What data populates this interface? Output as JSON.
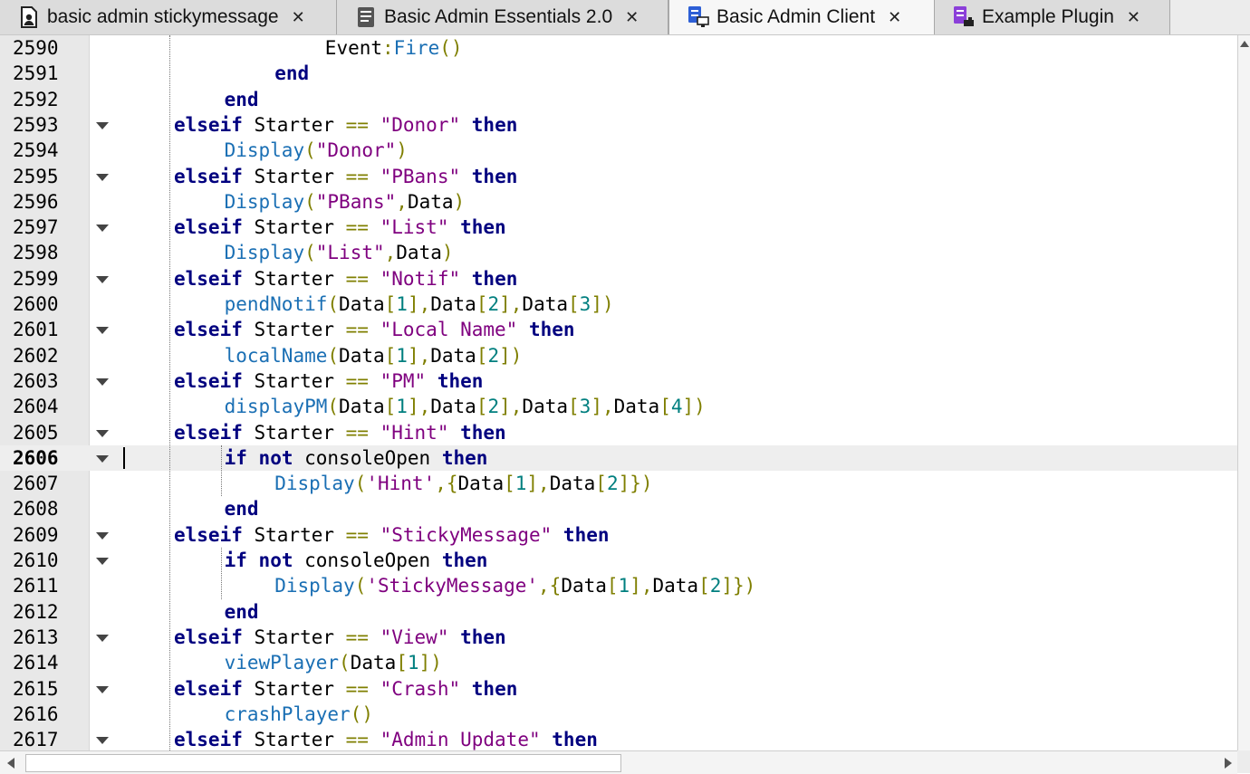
{
  "tabs": [
    {
      "label": "basic admin stickymessage",
      "icon": "script-person-icon",
      "active": false
    },
    {
      "label": "Basic Admin Essentials 2.0",
      "icon": "document-lines-icon",
      "active": false
    },
    {
      "label": "Basic Admin Client",
      "icon": "local-script-icon",
      "active": true
    },
    {
      "label": "Example Plugin",
      "icon": "module-script-icon",
      "active": false
    }
  ],
  "tab_close_glyph": "✕",
  "editor": {
    "current_line": 2606,
    "lines": [
      {
        "n": 2590,
        "fold": false,
        "indent": 3,
        "tokens": [
          [
            "id",
            "Event"
          ],
          [
            "op",
            ":"
          ],
          [
            "fn",
            "Fire"
          ],
          [
            "op",
            "()"
          ]
        ]
      },
      {
        "n": 2591,
        "fold": false,
        "indent": 2,
        "tokens": [
          [
            "kw",
            "end"
          ]
        ]
      },
      {
        "n": 2592,
        "fold": false,
        "indent": 1,
        "tokens": [
          [
            "kw",
            "end"
          ]
        ]
      },
      {
        "n": 2593,
        "fold": true,
        "indent": 0,
        "tokens": [
          [
            "kw",
            "elseif"
          ],
          [
            "id",
            " Starter "
          ],
          [
            "op",
            "=="
          ],
          [
            "id",
            " "
          ],
          [
            "st",
            "\"Donor\""
          ],
          [
            "id",
            " "
          ],
          [
            "kw",
            "then"
          ]
        ]
      },
      {
        "n": 2594,
        "fold": false,
        "indent": 1,
        "tokens": [
          [
            "fn",
            "Display"
          ],
          [
            "op",
            "("
          ],
          [
            "st",
            "\"Donor\""
          ],
          [
            "op",
            ")"
          ]
        ]
      },
      {
        "n": 2595,
        "fold": true,
        "indent": 0,
        "tokens": [
          [
            "kw",
            "elseif"
          ],
          [
            "id",
            " Starter "
          ],
          [
            "op",
            "=="
          ],
          [
            "id",
            " "
          ],
          [
            "st",
            "\"PBans\""
          ],
          [
            "id",
            " "
          ],
          [
            "kw",
            "then"
          ]
        ]
      },
      {
        "n": 2596,
        "fold": false,
        "indent": 1,
        "tokens": [
          [
            "fn",
            "Display"
          ],
          [
            "op",
            "("
          ],
          [
            "st",
            "\"PBans\""
          ],
          [
            "op",
            ","
          ],
          [
            "id",
            "Data"
          ],
          [
            "op",
            ")"
          ]
        ]
      },
      {
        "n": 2597,
        "fold": true,
        "indent": 0,
        "tokens": [
          [
            "kw",
            "elseif"
          ],
          [
            "id",
            " Starter "
          ],
          [
            "op",
            "=="
          ],
          [
            "id",
            " "
          ],
          [
            "st",
            "\"List\""
          ],
          [
            "id",
            " "
          ],
          [
            "kw",
            "then"
          ]
        ]
      },
      {
        "n": 2598,
        "fold": false,
        "indent": 1,
        "tokens": [
          [
            "fn",
            "Display"
          ],
          [
            "op",
            "("
          ],
          [
            "st",
            "\"List\""
          ],
          [
            "op",
            ","
          ],
          [
            "id",
            "Data"
          ],
          [
            "op",
            ")"
          ]
        ]
      },
      {
        "n": 2599,
        "fold": true,
        "indent": 0,
        "tokens": [
          [
            "kw",
            "elseif"
          ],
          [
            "id",
            " Starter "
          ],
          [
            "op",
            "=="
          ],
          [
            "id",
            " "
          ],
          [
            "st",
            "\"Notif\""
          ],
          [
            "id",
            " "
          ],
          [
            "kw",
            "then"
          ]
        ]
      },
      {
        "n": 2600,
        "fold": false,
        "indent": 1,
        "tokens": [
          [
            "fn",
            "pendNotif"
          ],
          [
            "op",
            "("
          ],
          [
            "id",
            "Data"
          ],
          [
            "op",
            "["
          ],
          [
            "nm",
            "1"
          ],
          [
            "op",
            "],"
          ],
          [
            "id",
            "Data"
          ],
          [
            "op",
            "["
          ],
          [
            "nm",
            "2"
          ],
          [
            "op",
            "],"
          ],
          [
            "id",
            "Data"
          ],
          [
            "op",
            "["
          ],
          [
            "nm",
            "3"
          ],
          [
            "op",
            "])"
          ]
        ]
      },
      {
        "n": 2601,
        "fold": true,
        "indent": 0,
        "tokens": [
          [
            "kw",
            "elseif"
          ],
          [
            "id",
            " Starter "
          ],
          [
            "op",
            "=="
          ],
          [
            "id",
            " "
          ],
          [
            "st",
            "\"Local Name\""
          ],
          [
            "id",
            " "
          ],
          [
            "kw",
            "then"
          ]
        ]
      },
      {
        "n": 2602,
        "fold": false,
        "indent": 1,
        "tokens": [
          [
            "fn",
            "localName"
          ],
          [
            "op",
            "("
          ],
          [
            "id",
            "Data"
          ],
          [
            "op",
            "["
          ],
          [
            "nm",
            "1"
          ],
          [
            "op",
            "],"
          ],
          [
            "id",
            "Data"
          ],
          [
            "op",
            "["
          ],
          [
            "nm",
            "2"
          ],
          [
            "op",
            "])"
          ]
        ]
      },
      {
        "n": 2603,
        "fold": true,
        "indent": 0,
        "tokens": [
          [
            "kw",
            "elseif"
          ],
          [
            "id",
            " Starter "
          ],
          [
            "op",
            "=="
          ],
          [
            "id",
            " "
          ],
          [
            "st",
            "\"PM\""
          ],
          [
            "id",
            " "
          ],
          [
            "kw",
            "then"
          ]
        ]
      },
      {
        "n": 2604,
        "fold": false,
        "indent": 1,
        "tokens": [
          [
            "fn",
            "displayPM"
          ],
          [
            "op",
            "("
          ],
          [
            "id",
            "Data"
          ],
          [
            "op",
            "["
          ],
          [
            "nm",
            "1"
          ],
          [
            "op",
            "],"
          ],
          [
            "id",
            "Data"
          ],
          [
            "op",
            "["
          ],
          [
            "nm",
            "2"
          ],
          [
            "op",
            "],"
          ],
          [
            "id",
            "Data"
          ],
          [
            "op",
            "["
          ],
          [
            "nm",
            "3"
          ],
          [
            "op",
            "],"
          ],
          [
            "id",
            "Data"
          ],
          [
            "op",
            "["
          ],
          [
            "nm",
            "4"
          ],
          [
            "op",
            "])"
          ]
        ]
      },
      {
        "n": 2605,
        "fold": true,
        "indent": 0,
        "tokens": [
          [
            "kw",
            "elseif"
          ],
          [
            "id",
            " Starter "
          ],
          [
            "op",
            "=="
          ],
          [
            "id",
            " "
          ],
          [
            "st",
            "\"Hint\""
          ],
          [
            "id",
            " "
          ],
          [
            "kw",
            "then"
          ]
        ]
      },
      {
        "n": 2606,
        "fold": true,
        "indent": 1,
        "tokens": [
          [
            "kw",
            "if"
          ],
          [
            "id",
            " "
          ],
          [
            "kw",
            "not"
          ],
          [
            "id",
            " consoleOpen "
          ],
          [
            "kw",
            "then"
          ]
        ]
      },
      {
        "n": 2607,
        "fold": false,
        "indent": 2,
        "tokens": [
          [
            "fn",
            "Display"
          ],
          [
            "op",
            "("
          ],
          [
            "st",
            "'Hint'"
          ],
          [
            "op",
            ",{"
          ],
          [
            "id",
            "Data"
          ],
          [
            "op",
            "["
          ],
          [
            "nm",
            "1"
          ],
          [
            "op",
            "],"
          ],
          [
            "id",
            "Data"
          ],
          [
            "op",
            "["
          ],
          [
            "nm",
            "2"
          ],
          [
            "op",
            "]})"
          ]
        ]
      },
      {
        "n": 2608,
        "fold": false,
        "indent": 1,
        "tokens": [
          [
            "kw",
            "end"
          ]
        ]
      },
      {
        "n": 2609,
        "fold": true,
        "indent": 0,
        "tokens": [
          [
            "kw",
            "elseif"
          ],
          [
            "id",
            " Starter "
          ],
          [
            "op",
            "=="
          ],
          [
            "id",
            " "
          ],
          [
            "st",
            "\"StickyMessage\""
          ],
          [
            "id",
            " "
          ],
          [
            "kw",
            "then"
          ]
        ]
      },
      {
        "n": 2610,
        "fold": true,
        "indent": 1,
        "tokens": [
          [
            "kw",
            "if"
          ],
          [
            "id",
            " "
          ],
          [
            "kw",
            "not"
          ],
          [
            "id",
            " consoleOpen "
          ],
          [
            "kw",
            "then"
          ]
        ]
      },
      {
        "n": 2611,
        "fold": false,
        "indent": 2,
        "tokens": [
          [
            "fn",
            "Display"
          ],
          [
            "op",
            "("
          ],
          [
            "st",
            "'StickyMessage'"
          ],
          [
            "op",
            ",{"
          ],
          [
            "id",
            "Data"
          ],
          [
            "op",
            "["
          ],
          [
            "nm",
            "1"
          ],
          [
            "op",
            "],"
          ],
          [
            "id",
            "Data"
          ],
          [
            "op",
            "["
          ],
          [
            "nm",
            "2"
          ],
          [
            "op",
            "]})"
          ]
        ]
      },
      {
        "n": 2612,
        "fold": false,
        "indent": 1,
        "tokens": [
          [
            "kw",
            "end"
          ]
        ]
      },
      {
        "n": 2613,
        "fold": true,
        "indent": 0,
        "tokens": [
          [
            "kw",
            "elseif"
          ],
          [
            "id",
            " Starter "
          ],
          [
            "op",
            "=="
          ],
          [
            "id",
            " "
          ],
          [
            "st",
            "\"View\""
          ],
          [
            "id",
            " "
          ],
          [
            "kw",
            "then"
          ]
        ]
      },
      {
        "n": 2614,
        "fold": false,
        "indent": 1,
        "tokens": [
          [
            "fn",
            "viewPlayer"
          ],
          [
            "op",
            "("
          ],
          [
            "id",
            "Data"
          ],
          [
            "op",
            "["
          ],
          [
            "nm",
            "1"
          ],
          [
            "op",
            "])"
          ]
        ]
      },
      {
        "n": 2615,
        "fold": true,
        "indent": 0,
        "tokens": [
          [
            "kw",
            "elseif"
          ],
          [
            "id",
            " Starter "
          ],
          [
            "op",
            "=="
          ],
          [
            "id",
            " "
          ],
          [
            "st",
            "\"Crash\""
          ],
          [
            "id",
            " "
          ],
          [
            "kw",
            "then"
          ]
        ]
      },
      {
        "n": 2616,
        "fold": false,
        "indent": 1,
        "tokens": [
          [
            "fn",
            "crashPlayer"
          ],
          [
            "op",
            "()"
          ]
        ]
      },
      {
        "n": 2617,
        "fold": true,
        "indent": 0,
        "tokens": [
          [
            "kw",
            "elseif"
          ],
          [
            "id",
            " Starter "
          ],
          [
            "op",
            "=="
          ],
          [
            "id",
            " "
          ],
          [
            "st",
            "\"Admin Update\""
          ],
          [
            "id",
            " "
          ],
          [
            "kw",
            "then"
          ]
        ]
      }
    ]
  }
}
